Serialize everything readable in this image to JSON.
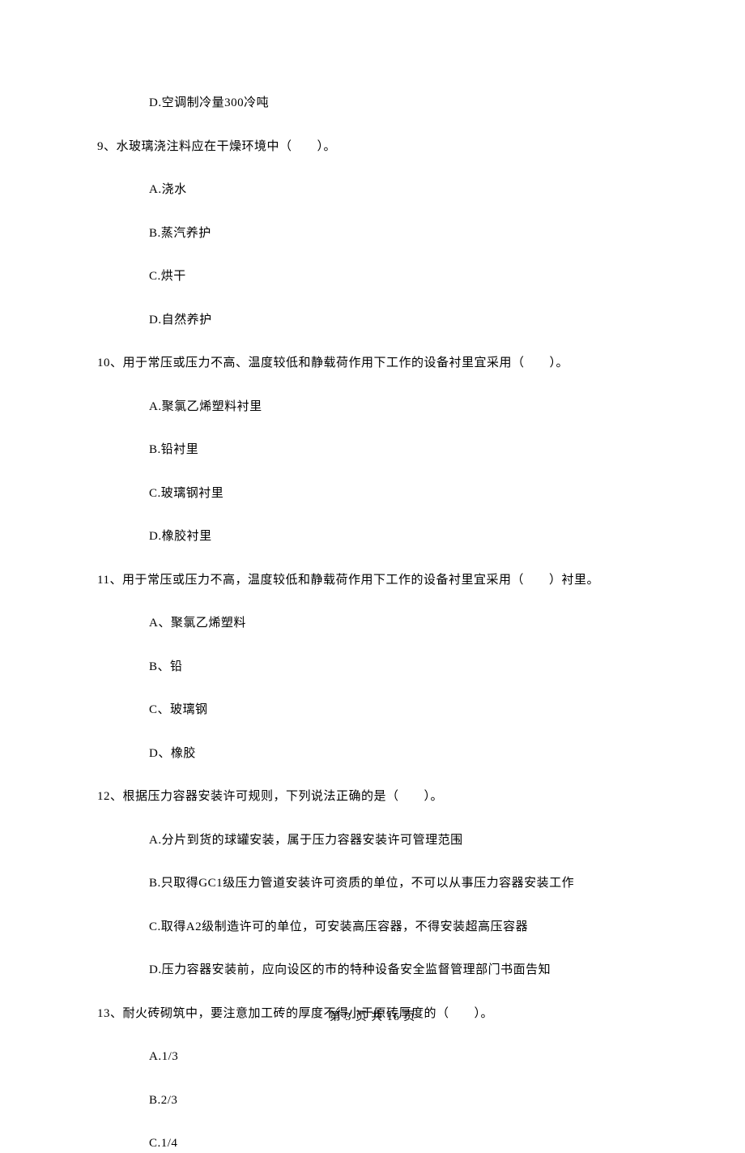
{
  "item_d_prev": "D.空调制冷量300冷吨",
  "q9": {
    "num": "9、",
    "text": "水玻璃浇注料应在干燥环境中（　　）。",
    "options": {
      "a": "A.浇水",
      "b": "B.蒸汽养护",
      "c": "C.烘干",
      "d": "D.自然养护"
    }
  },
  "q10": {
    "num": "10、",
    "text": "用于常压或压力不高、温度较低和静载荷作用下工作的设备衬里宜采用（　　）。",
    "options": {
      "a": "A.聚氯乙烯塑料衬里",
      "b": "B.铅衬里",
      "c": "C.玻璃钢衬里",
      "d": "D.橡胶衬里"
    }
  },
  "q11": {
    "num": "11、",
    "text": "用于常压或压力不高，温度较低和静载荷作用下工作的设备衬里宜采用（　　）衬里。",
    "options": {
      "a": "A、聚氯乙烯塑料",
      "b": "B、铅",
      "c": "C、玻璃钢",
      "d": "D、橡胶"
    }
  },
  "q12": {
    "num": "12、",
    "text": "根据压力容器安装许可规则，下列说法正确的是（　　）。",
    "options": {
      "a": "A.分片到货的球罐安装，属于压力容器安装许可管理范围",
      "b": "B.只取得GC1级压力管道安装许可资质的单位，不可以从事压力容器安装工作",
      "c": "C.取得A2级制造许可的单位，可安装高压容器，不得安装超高压容器",
      "d": "D.压力容器安装前，应向设区的市的特种设备安全监督管理部门书面告知"
    }
  },
  "q13": {
    "num": "13、",
    "text": "耐火砖砌筑中，要注意加工砖的厚度不得小于原砖厚度的（　　）。",
    "options": {
      "a": "A.1/3",
      "b": "B.2/3",
      "c": "C.1/4"
    }
  },
  "footer": "第 3 页 共 16 页"
}
